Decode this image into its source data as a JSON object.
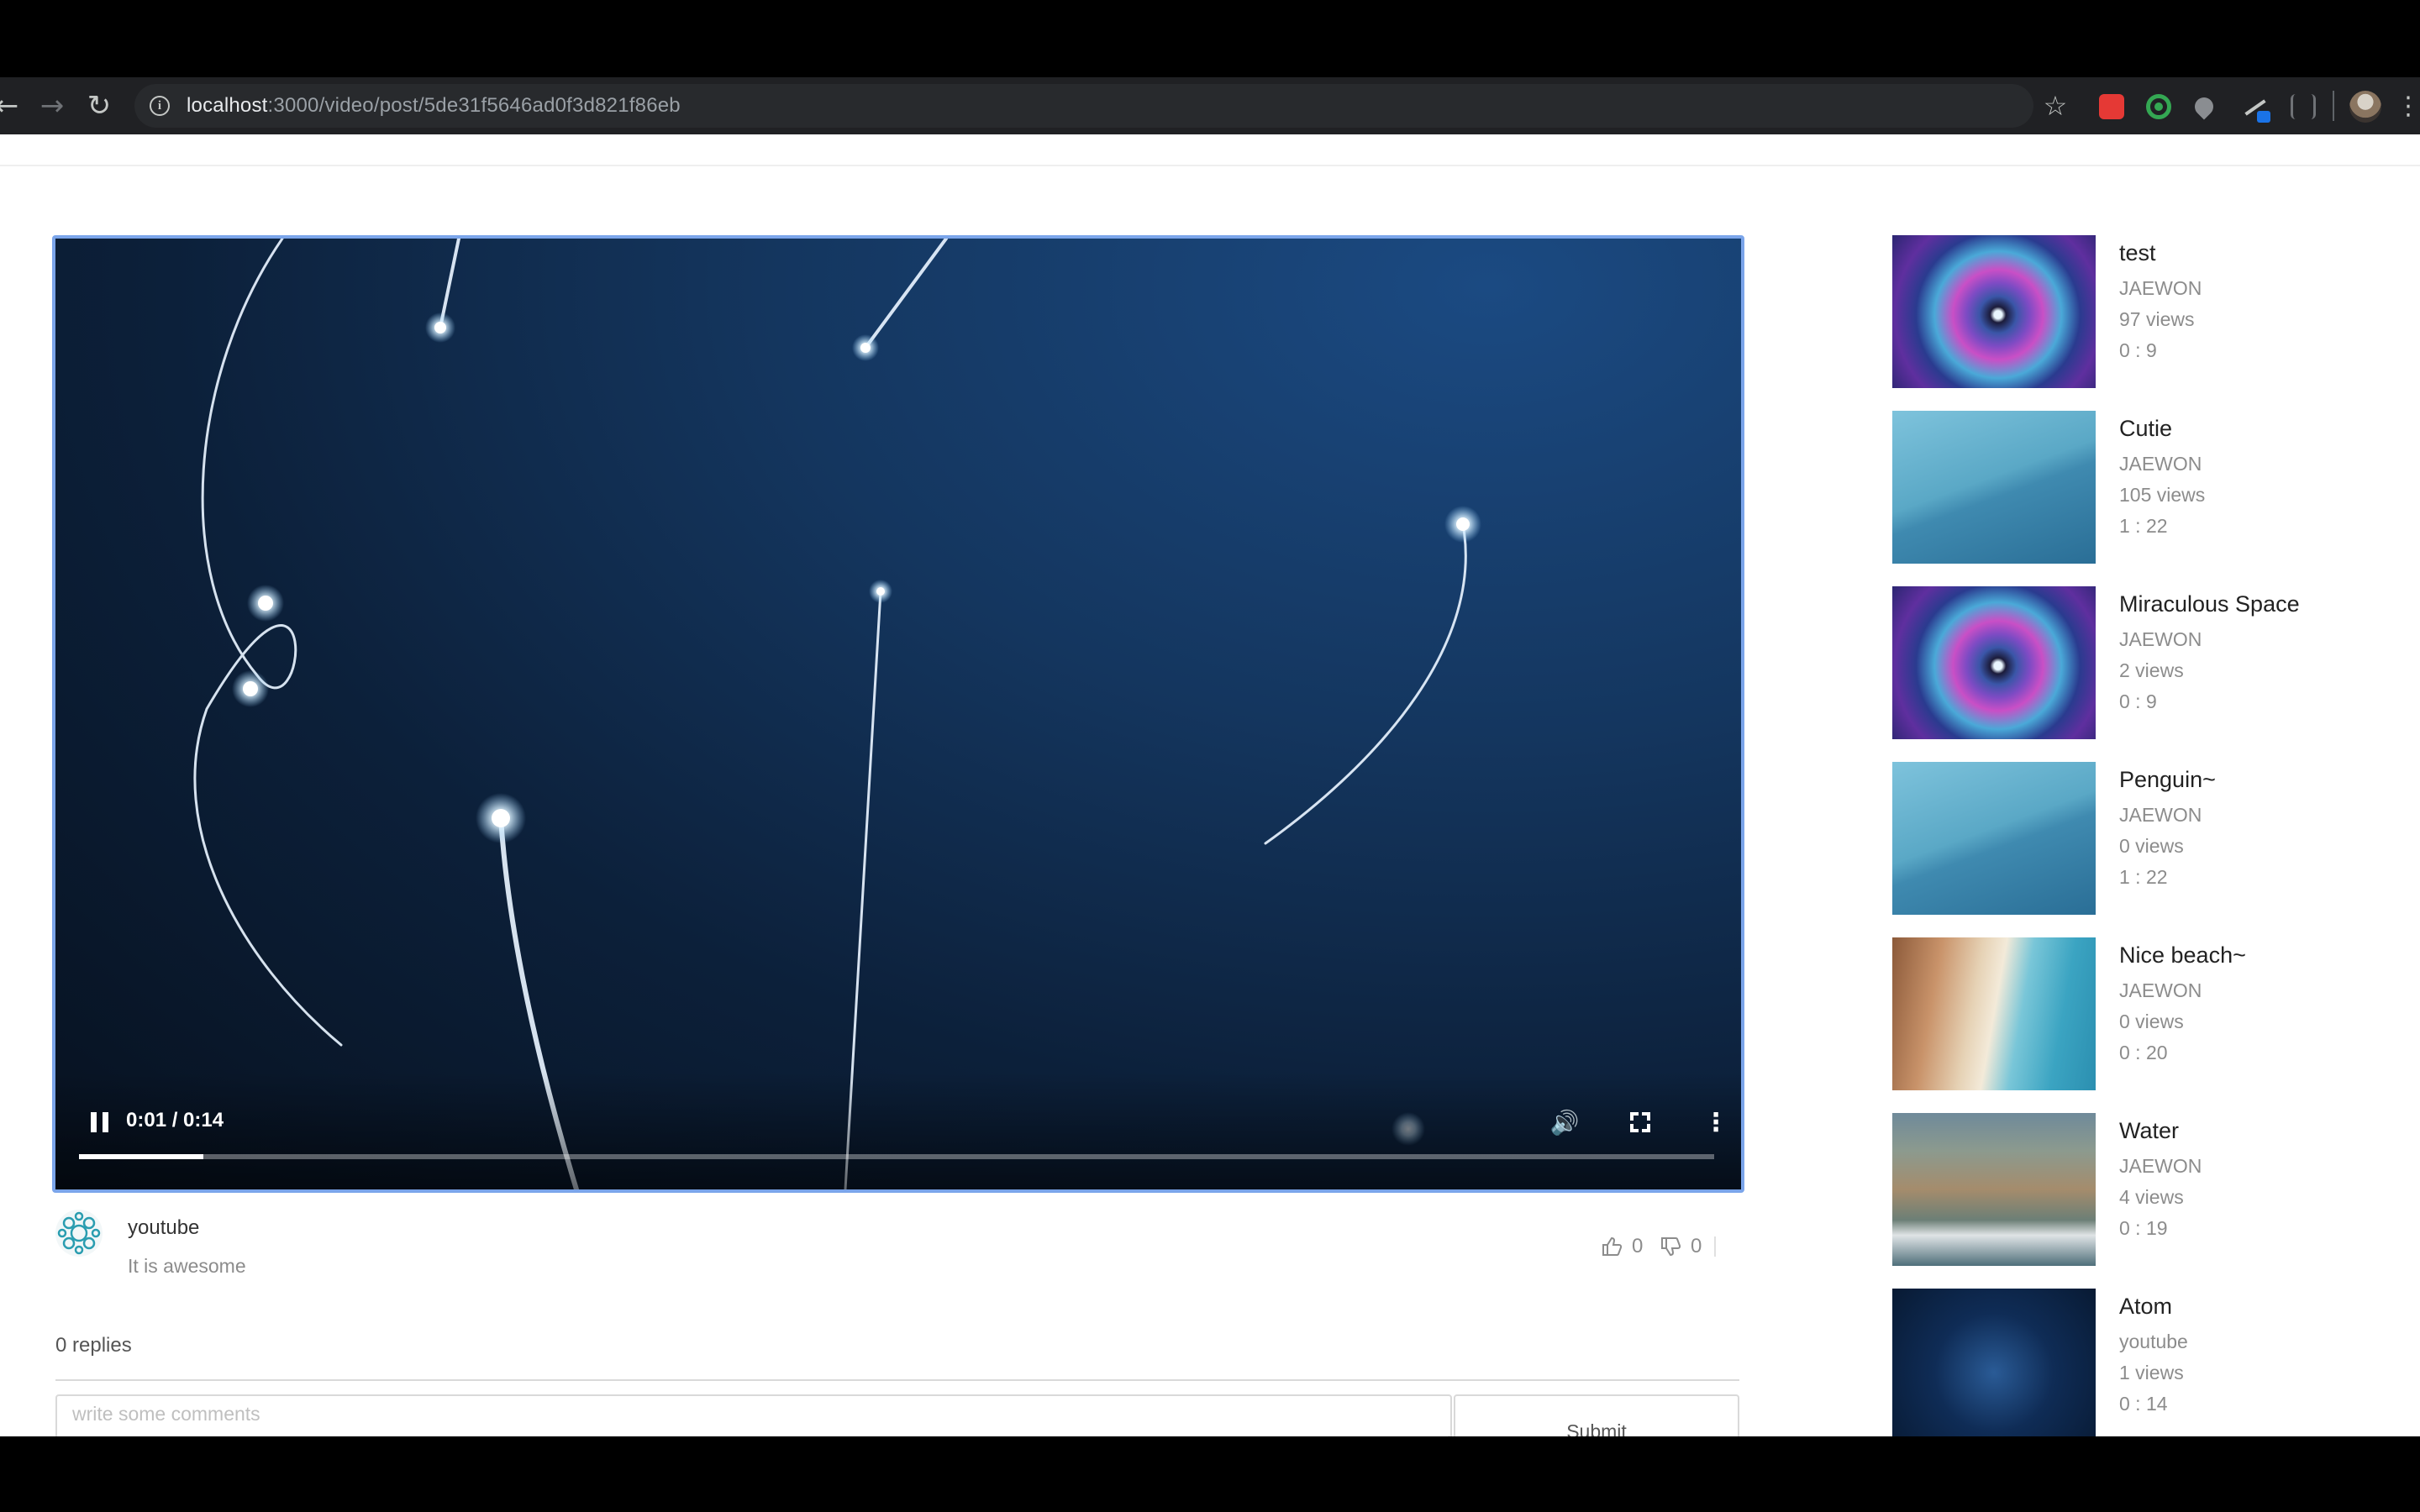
{
  "browser": {
    "url_host": "localhost",
    "url_path": ":3000/video/post/5de31f5646ad0f3d821f86eb"
  },
  "player": {
    "time_display": "0:01 / 0:14",
    "progress": 0.0762
  },
  "comment": {
    "author": "youtube",
    "text": "It is awesome",
    "likes": "0",
    "dislikes": "0"
  },
  "replies_label": "0 replies",
  "comment_form": {
    "placeholder": "write some comments",
    "submit_label": "Submit"
  },
  "sidebar": {
    "items": [
      {
        "title": "test",
        "author": "JAEWON",
        "views": "97 views",
        "duration": "0 : 9",
        "thumb": "space"
      },
      {
        "title": "Cutie",
        "author": "JAEWON",
        "views": "105 views",
        "duration": "1 : 22",
        "thumb": "penguin"
      },
      {
        "title": "Miraculous Space",
        "author": "JAEWON",
        "views": "2 views",
        "duration": "0 : 9",
        "thumb": "space"
      },
      {
        "title": "Penguin~",
        "author": "JAEWON",
        "views": "0 views",
        "duration": "1 : 22",
        "thumb": "penguin"
      },
      {
        "title": "Nice beach~",
        "author": "JAEWON",
        "views": "0 views",
        "duration": "0 : 20",
        "thumb": "beach"
      },
      {
        "title": "Water",
        "author": "JAEWON",
        "views": "4 views",
        "duration": "0 : 19",
        "thumb": "water"
      },
      {
        "title": "Atom",
        "author": "youtube",
        "views": "1 views",
        "duration": "0 : 14",
        "thumb": "atom"
      }
    ]
  },
  "colors": {
    "player_border": "#7ba5ea",
    "browser_toolbar": "#202124"
  }
}
